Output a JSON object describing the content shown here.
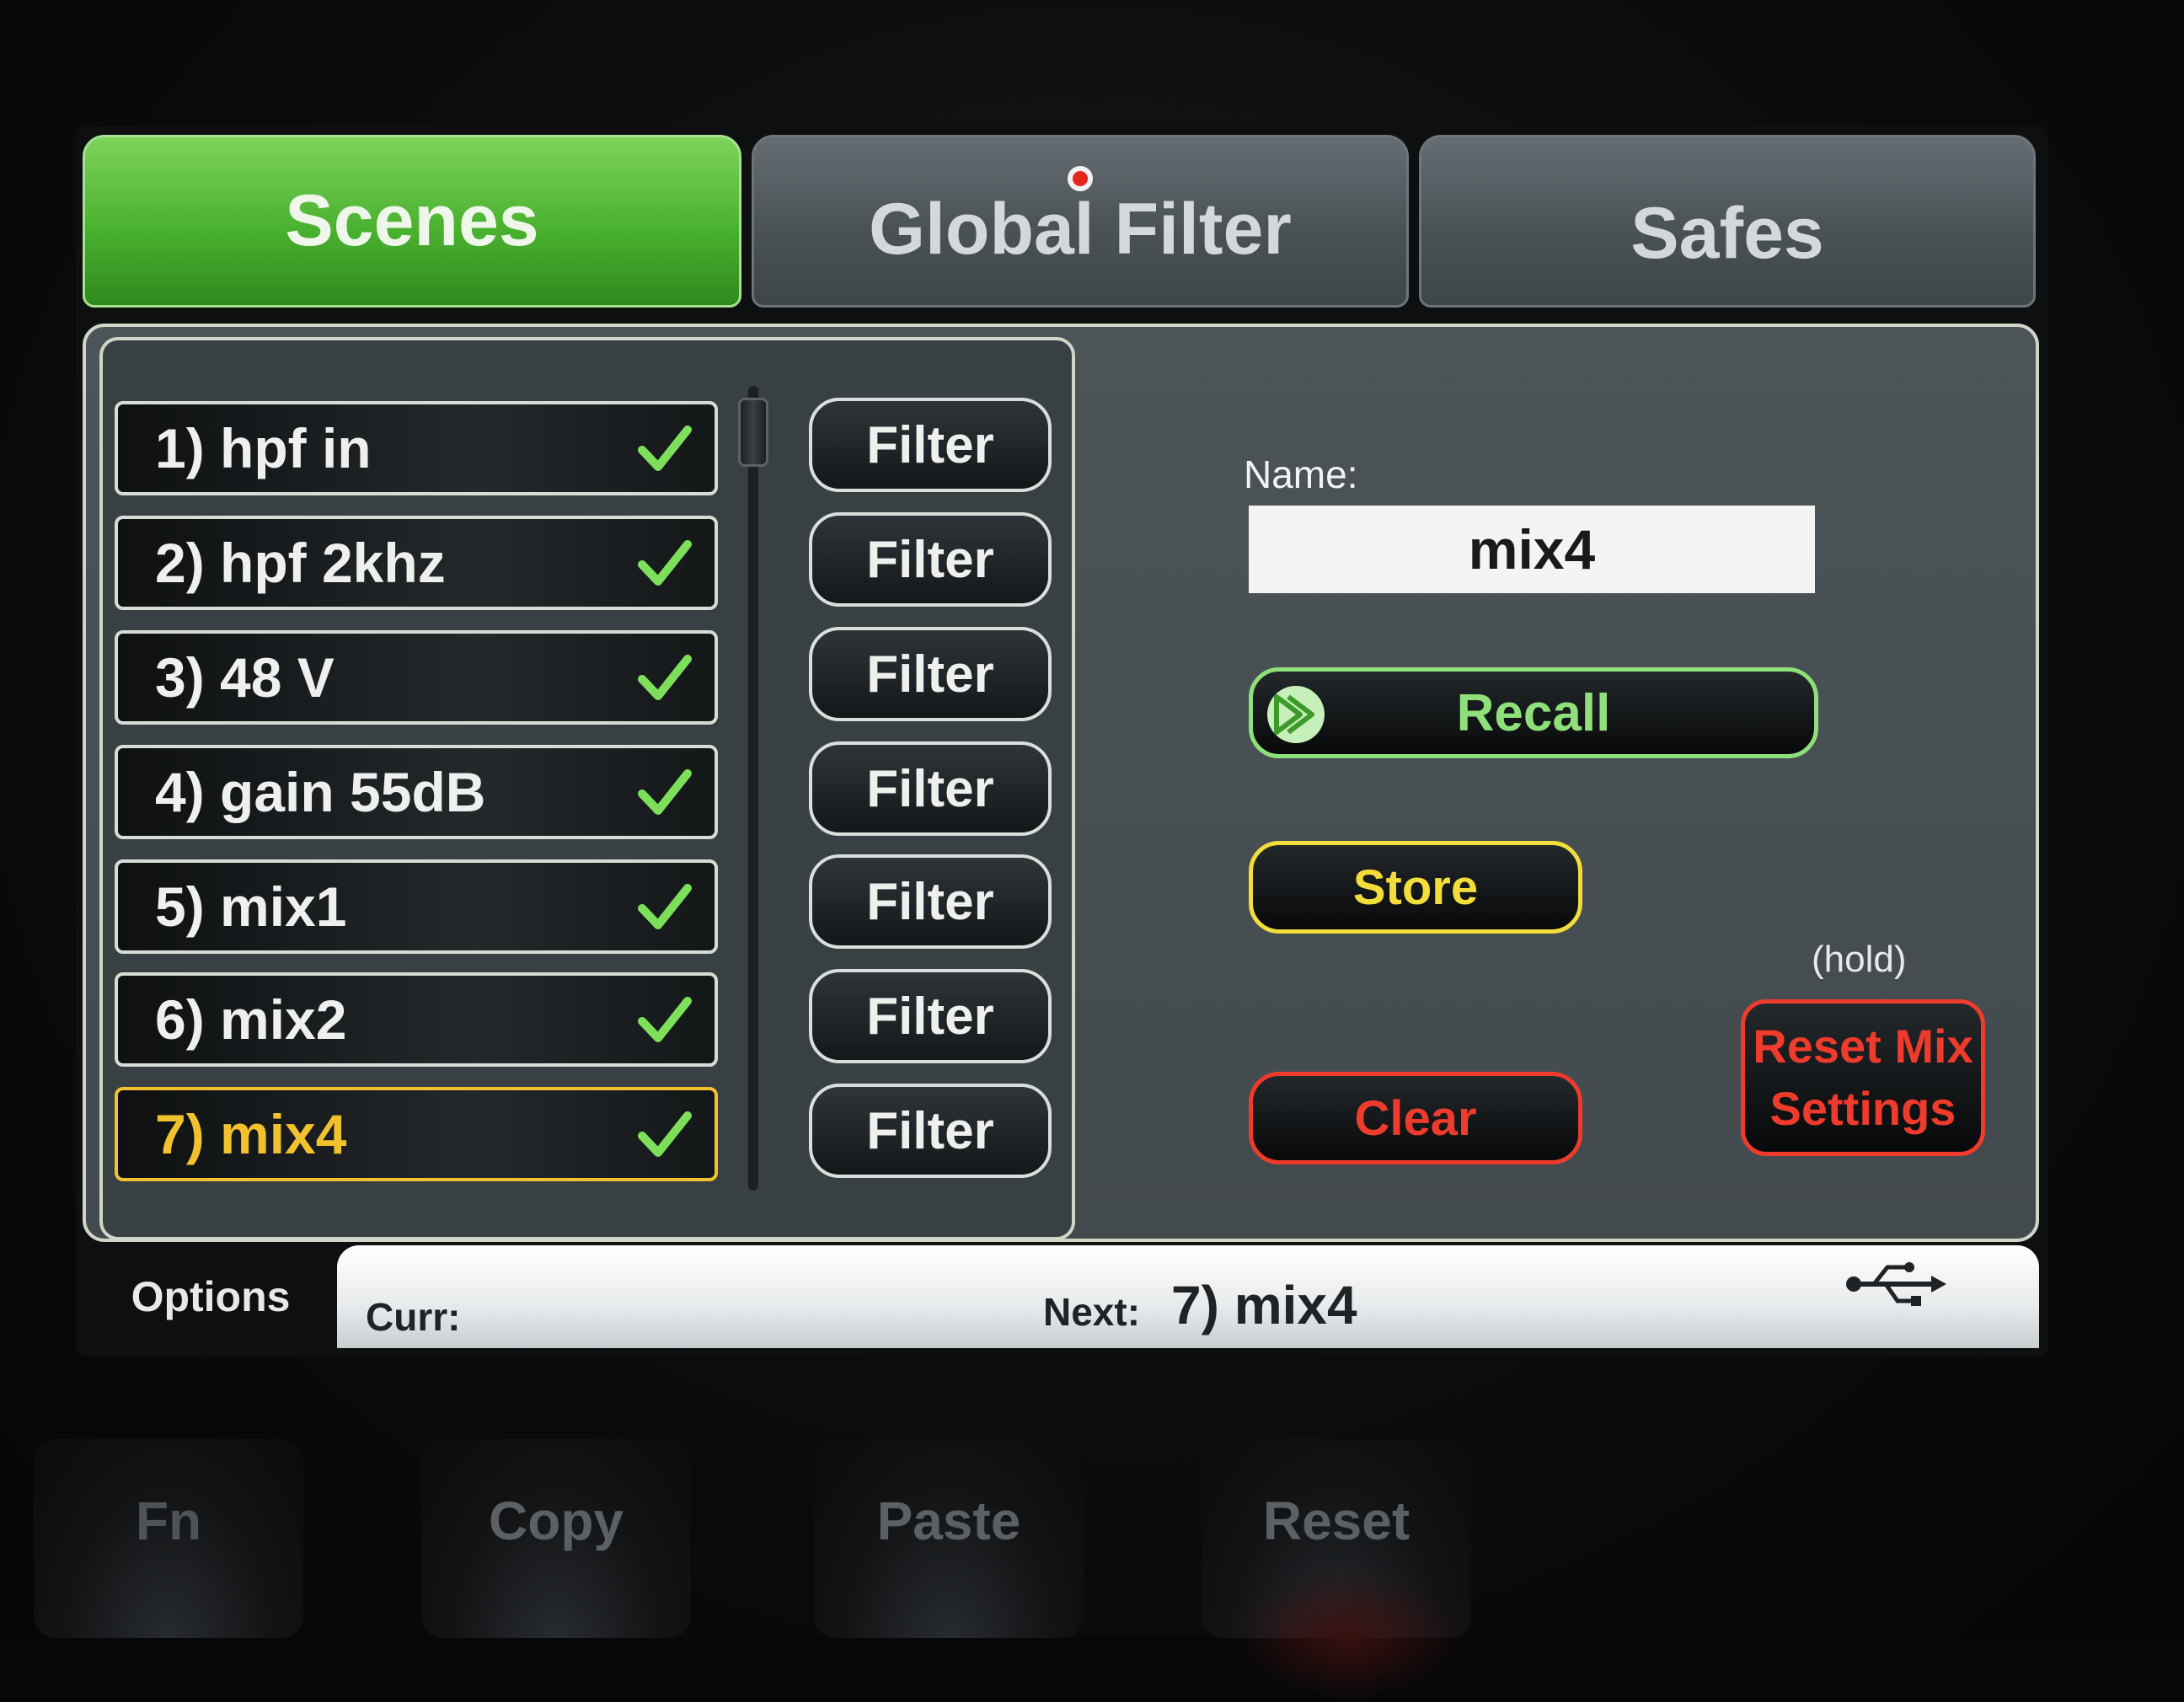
{
  "tabs": [
    {
      "label": "Scenes",
      "active": true
    },
    {
      "label": "Global Filter",
      "active": false,
      "indicator": "red-dot"
    },
    {
      "label": "Safes",
      "active": false
    }
  ],
  "scenes": [
    {
      "label": "1) hpf in",
      "checked": true,
      "filter_label": "Filter"
    },
    {
      "label": "2) hpf 2khz",
      "checked": true,
      "filter_label": "Filter"
    },
    {
      "label": "3) 48 V",
      "checked": true,
      "filter_label": "Filter"
    },
    {
      "label": "4) gain 55dB",
      "checked": true,
      "filter_label": "Filter"
    },
    {
      "label": "5) mix1",
      "checked": true,
      "filter_label": "Filter"
    },
    {
      "label": "6) mix2",
      "checked": true,
      "filter_label": "Filter"
    },
    {
      "label": "7) mix4",
      "checked": true,
      "filter_label": "Filter",
      "selected": true
    }
  ],
  "detail": {
    "name_label": "Name:",
    "name_value": "mix4",
    "recall_label": "Recall",
    "store_label": "Store",
    "clear_label": "Clear",
    "hold_label": "(hold)",
    "reset_line1": "Reset Mix",
    "reset_line2": "Settings"
  },
  "status": {
    "options_label": "Options",
    "curr_label": "Curr:",
    "next_label": "Next:",
    "next_value": "7) mix4",
    "usb_icon": "usb-icon"
  },
  "hardware_buttons": [
    "Fn",
    "Copy",
    "Paste",
    "Reset"
  ],
  "colors": {
    "active_tab": "#4ab12f",
    "check": "#7ee05a",
    "selected": "#f2c12e",
    "recall": "#8fe07a",
    "store": "#f2dd3a",
    "clear": "#ee3b2c"
  }
}
